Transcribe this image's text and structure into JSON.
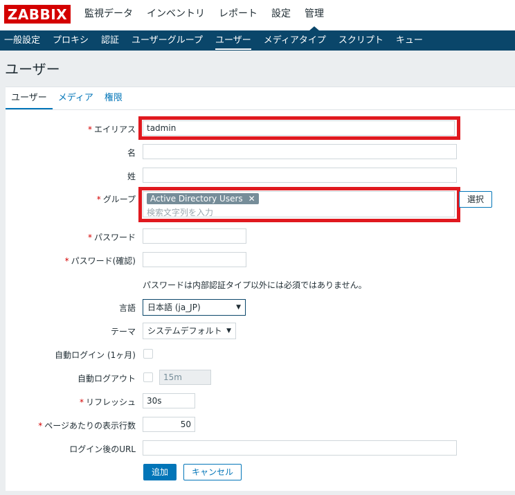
{
  "header": {
    "logo": "ZABBIX",
    "menu": [
      "監視データ",
      "インベントリ",
      "レポート",
      "設定",
      "管理"
    ],
    "active_menu": "管理"
  },
  "subnav": {
    "items": [
      "一般設定",
      "プロキシ",
      "認証",
      "ユーザーグループ",
      "ユーザー",
      "メディアタイプ",
      "スクリプト",
      "キュー"
    ],
    "active": "ユーザー"
  },
  "page": {
    "title": "ユーザー"
  },
  "tabs": [
    "ユーザー",
    "メディア",
    "権限"
  ],
  "form": {
    "required_mark": "*",
    "alias": {
      "label": "エイリアス",
      "value": "tadmin"
    },
    "name": {
      "label": "名",
      "value": ""
    },
    "surname": {
      "label": "姓",
      "value": ""
    },
    "groups": {
      "label": "グループ",
      "tags": [
        "Active Directory Users"
      ],
      "remove_glyph": "✕",
      "placeholder": "検索文字列を入力",
      "select_button": "選択"
    },
    "password": {
      "label": "パスワード",
      "value": ""
    },
    "password_confirm": {
      "label": "パスワード(確認)",
      "value": ""
    },
    "password_note": "パスワードは内部認証タイプ以外には必須ではありません。",
    "language": {
      "label": "言語",
      "value": "日本語 (ja_JP)"
    },
    "theme": {
      "label": "テーマ",
      "value": "システムデフォルト"
    },
    "autologin": {
      "label": "自動ログイン (1ヶ月)",
      "checked": false
    },
    "autologout": {
      "label": "自動ログアウト",
      "checked": false,
      "value": "15m"
    },
    "refresh": {
      "label": "リフレッシュ",
      "value": "30s"
    },
    "rows_per_page": {
      "label": "ページあたりの表示行数",
      "value": "50"
    },
    "url": {
      "label": "ログイン後のURL",
      "value": ""
    },
    "add_button": "追加",
    "cancel_button": "キャンセル"
  },
  "colors": {
    "brand": "#d40000",
    "nav_bg": "#0a466a",
    "accent": "#0275b8",
    "highlight_box": "#e0191f"
  },
  "icons": {
    "dropdown": "chevron-down-icon",
    "tag_remove": "close-icon"
  }
}
